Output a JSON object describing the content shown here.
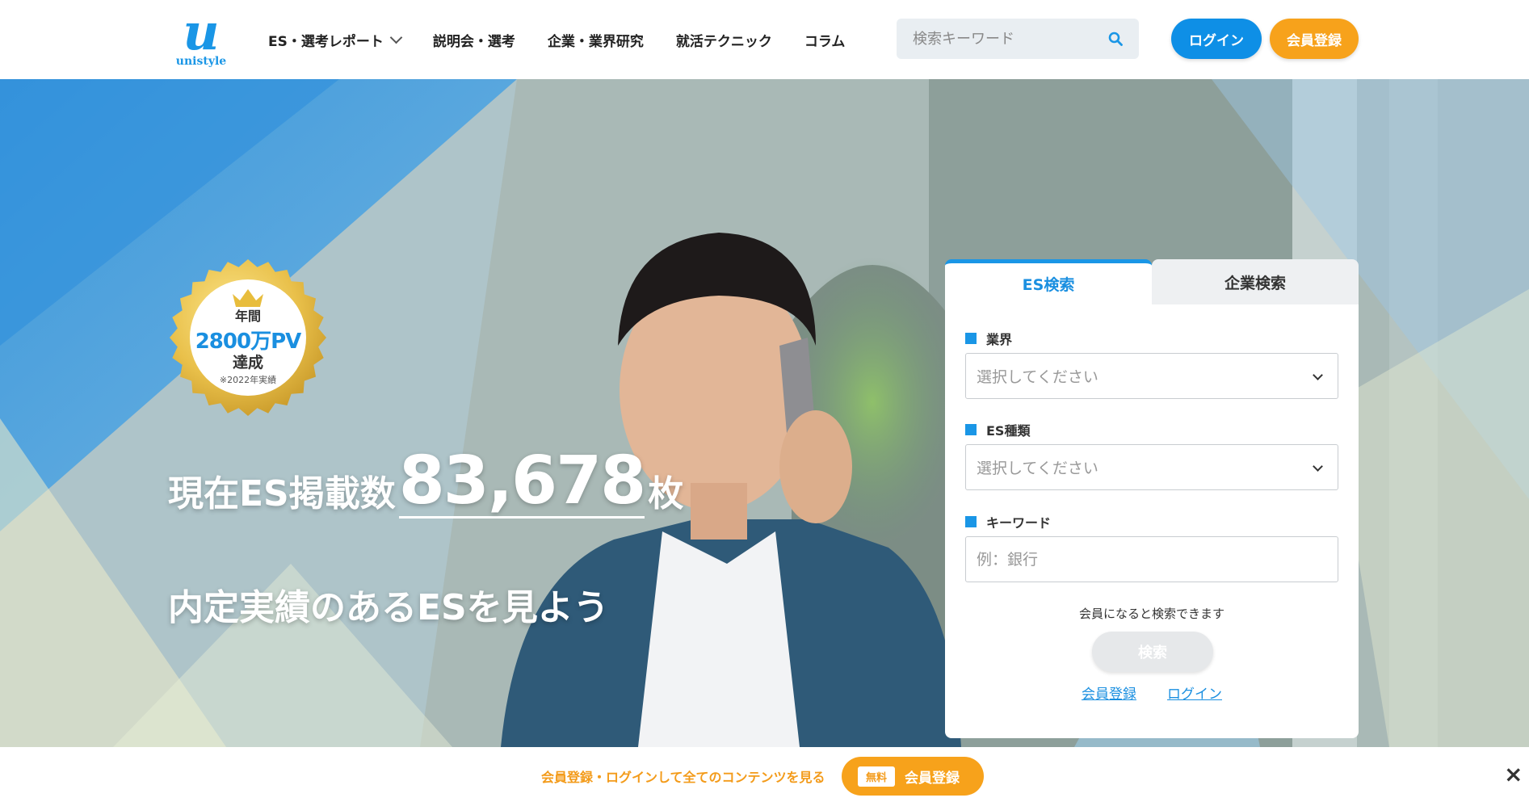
{
  "header": {
    "logo_text": "unistyle",
    "logo_mark": "u",
    "nav": [
      {
        "label": "ES・選考レポート",
        "has_dropdown": true
      },
      {
        "label": "説明会・選考"
      },
      {
        "label": "企業・業界研究"
      },
      {
        "label": "就活テクニック"
      },
      {
        "label": "コラム"
      }
    ],
    "search_placeholder": "検索キーワード",
    "login_label": "ログイン",
    "register_label": "会員登録"
  },
  "hero": {
    "badge": {
      "line1": "年間",
      "line2": "2800万PV",
      "line3": "達成",
      "note": "※2022年実績"
    },
    "count_prefix": "現在ES掲載数",
    "count_value": "83,678",
    "count_suffix": "枚",
    "tagline": "内定実績のあるESを見よう"
  },
  "search_panel": {
    "tab_es": "ES検索",
    "tab_company": "企業検索",
    "industry_label": "業界",
    "industry_value": "選択してください",
    "es_type_label": "ES種類",
    "es_type_value": "選択してください",
    "keyword_label": "キーワード",
    "keyword_placeholder": "例：銀行",
    "member_note": "会員になると検索できます",
    "search_button": "検索",
    "register_link": "会員登録",
    "login_link": "ログイン"
  },
  "bottom_bar": {
    "text": "会員登録・ログインして全てのコンテンツを見る",
    "free_tag": "無料",
    "button_label": "会員登録",
    "close_label": "×"
  },
  "colors": {
    "brand_blue": "#1a96e6",
    "accent_orange": "#f7a21b",
    "text_dark": "#222222"
  }
}
